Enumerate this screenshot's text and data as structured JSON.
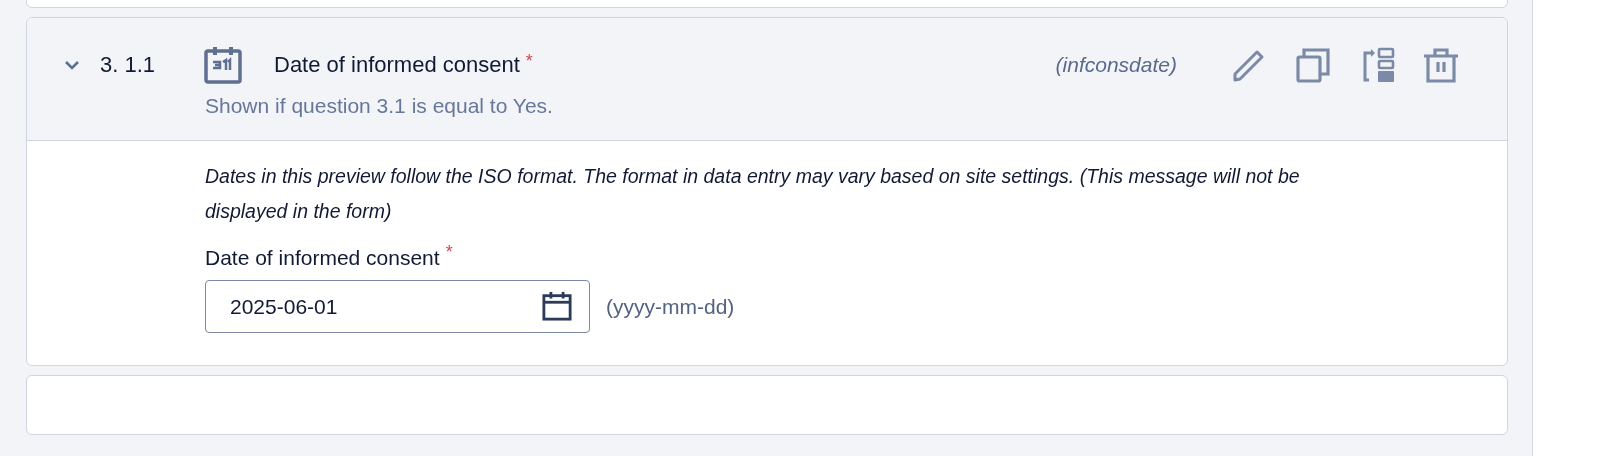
{
  "question": {
    "expanded": true,
    "number": "3. 1.1",
    "title": "Date of informed consent",
    "required": true,
    "required_mark": "*",
    "variable": "(infconsdate)",
    "condition": "Shown if question 3.1 is equal to Yes.",
    "note": "Dates in this preview follow the ISO format. The format in data entry may vary based on site settings. (This message will not be displayed in the form)",
    "field": {
      "label": "Date of informed consent",
      "required": true,
      "required_mark": "*",
      "value": "2025-06-01",
      "format_hint": "(yyyy-mm-dd)"
    }
  }
}
